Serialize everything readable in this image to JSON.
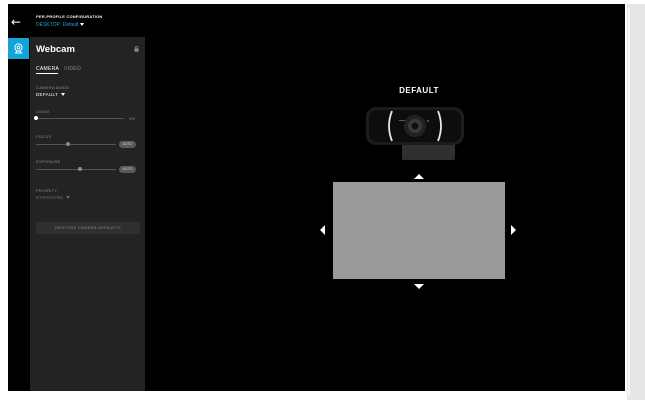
{
  "header": {
    "title": "PER-PROFILE CONFIGURATION",
    "profile_selector": "DESKTOP: Default"
  },
  "panel": {
    "title": "Webcam",
    "tabs": [
      {
        "label": "CAMERA",
        "active": true
      },
      {
        "label": "VIDEO",
        "active": false
      }
    ],
    "camera_mode": {
      "label": "CAMERA MODE",
      "value": "DEFAULT"
    },
    "zoom": {
      "label": "ZOOM",
      "value": "0%",
      "level": 0
    },
    "focus": {
      "label": "FOCUS",
      "level": 0.4,
      "auto_label": "AUTO"
    },
    "exposure": {
      "label": "EXPOSURE",
      "level": 0.55,
      "auto_label": "AUTO"
    },
    "priority": {
      "label": "PRIORITY",
      "value": "EXPOSURE"
    },
    "restore_label": "RESTORE CAMERA DEFAULTS"
  },
  "preview": {
    "title": "DEFAULT",
    "preview_color": "#999999"
  },
  "colors": {
    "accent": "#12a4d6",
    "background": "#000000",
    "panel": "#232323"
  },
  "icons": [
    "back-arrow-icon",
    "webcam-device-icon",
    "lock-icon",
    "caret-down-icon",
    "arrow-up-icon",
    "arrow-down-icon",
    "arrow-left-icon",
    "arrow-right-icon"
  ]
}
